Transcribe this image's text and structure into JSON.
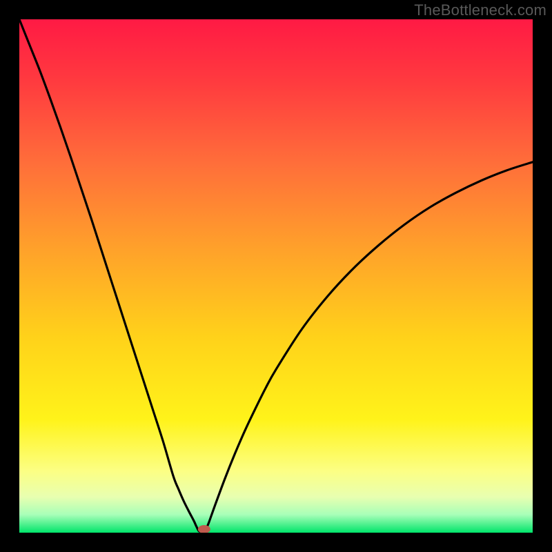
{
  "watermark": "TheBottleneck.com",
  "chart_data": {
    "type": "line",
    "title": "",
    "xlabel": "",
    "ylabel": "",
    "xlim": [
      0,
      100
    ],
    "ylim": [
      0,
      100
    ],
    "x_at_min": 35,
    "marker": {
      "x": 36,
      "y": 0,
      "color": "#bf5a4d"
    },
    "series": [
      {
        "name": "curve",
        "color": "#000000",
        "x": [
          0,
          2,
          4,
          6,
          8,
          10,
          12,
          14,
          16,
          18,
          20,
          22,
          24,
          26,
          28,
          30,
          31,
          32,
          33,
          34,
          34.5,
          35,
          35.5,
          36,
          36.5,
          37,
          38,
          40,
          42,
          44,
          46,
          48,
          50,
          55,
          60,
          65,
          70,
          75,
          80,
          85,
          90,
          95,
          100
        ],
        "y": [
          100,
          95,
          90,
          84.6,
          79,
          73.2,
          67.2,
          61.2,
          55,
          48.8,
          42.6,
          36.4,
          30.2,
          24,
          17.8,
          11,
          8.5,
          6.2,
          4.2,
          2.3,
          1.2,
          0.3,
          0.3,
          0.3,
          1.0,
          2.2,
          5.0,
          10.4,
          15.4,
          20.0,
          24.2,
          28.2,
          31.8,
          39.6,
          46.0,
          51.4,
          56.0,
          60.0,
          63.4,
          66.2,
          68.6,
          70.6,
          72.2
        ]
      }
    ],
    "background_gradient": {
      "stops": [
        {
          "offset": 0.0,
          "color": "#ff1a44"
        },
        {
          "offset": 0.12,
          "color": "#ff3a3f"
        },
        {
          "offset": 0.28,
          "color": "#ff6e3a"
        },
        {
          "offset": 0.45,
          "color": "#ffa22a"
        },
        {
          "offset": 0.62,
          "color": "#ffd21a"
        },
        {
          "offset": 0.78,
          "color": "#fff31a"
        },
        {
          "offset": 0.88,
          "color": "#fcff84"
        },
        {
          "offset": 0.93,
          "color": "#e8ffb0"
        },
        {
          "offset": 0.965,
          "color": "#a8ffb8"
        },
        {
          "offset": 1.0,
          "color": "#00e56a"
        }
      ]
    }
  }
}
